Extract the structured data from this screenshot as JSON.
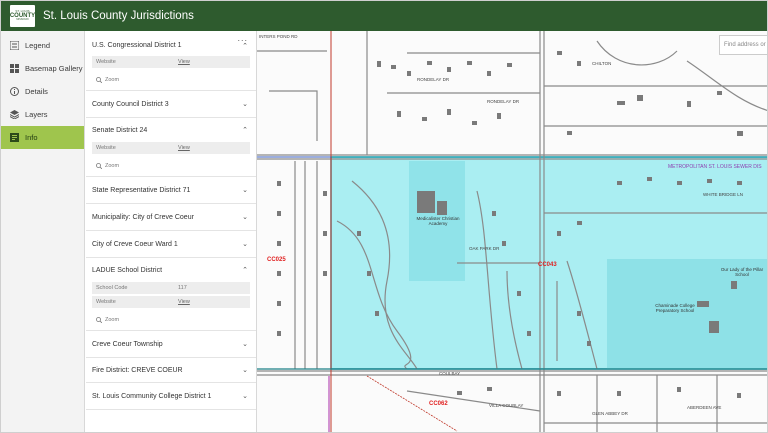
{
  "header": {
    "title": "St. Louis County Jurisdictions",
    "logo": {
      "line1": "ST. LOUIS",
      "line2": "COUNTY",
      "line3": "MISSOURI"
    }
  },
  "nav": {
    "items": [
      {
        "label": "Legend",
        "icon": "legend-icon"
      },
      {
        "label": "Basemap Gallery",
        "icon": "basemap-icon"
      },
      {
        "label": "Details",
        "icon": "info-icon"
      },
      {
        "label": "Layers",
        "icon": "layers-icon"
      },
      {
        "label": "Info",
        "icon": "info-card-icon",
        "active": true
      }
    ]
  },
  "panel": {
    "menu": "...",
    "sections": [
      {
        "title": "U.S. Congressional District 1",
        "expanded": true,
        "rows": [
          {
            "k": "Website",
            "v": "View"
          }
        ],
        "zoom": "Zoom"
      },
      {
        "title": "County Council District 3",
        "expanded": false
      },
      {
        "title": "Senate District 24",
        "expanded": true,
        "rows": [
          {
            "k": "Website",
            "v": "View"
          }
        ],
        "zoom": "Zoom"
      },
      {
        "title": "State Representative District 71",
        "expanded": false
      },
      {
        "title": "Municipality: City of Creve Coeur",
        "expanded": false
      },
      {
        "title": "City of Creve Coeur Ward 1",
        "expanded": false
      },
      {
        "title": "LADUE School District",
        "expanded": true,
        "rows": [
          {
            "k": "School Code",
            "v": "117"
          },
          {
            "k": "Website",
            "v": "View"
          }
        ],
        "zoom": "Zoom"
      },
      {
        "title": "Creve Coeur Township",
        "expanded": false
      },
      {
        "title": "Fire District: CREVE COEUR",
        "expanded": false
      },
      {
        "title": "St. Louis Community College District 1",
        "expanded": false
      }
    ]
  },
  "map": {
    "search_placeholder": "Find address or",
    "labels": {
      "cc043": "CC043",
      "cc025": "CC025",
      "cc062": "CC062",
      "msd": "METROPOLITAN ST. LOUIS SEWER DIS",
      "academy": "Medicalister Christian Academy",
      "chaminade": "Chaminade College Preparatory School",
      "olp": "Our Lady of the Pillar School",
      "dr1": "RONDELAY DR",
      "dr2": "RONDELAY DR",
      "dr3": "CHILTON",
      "dr4": "WHITE BRIDGE LN",
      "dr5": "OAK PARK DR",
      "dr6": "COULBAY",
      "dr7": "GLEN ABBEY DR",
      "dr8": "INTERS POND RD",
      "dr9": "VILLA COUBLAY",
      "dr10": "ABERDEEN AVE"
    },
    "colors": {
      "highlight": "#8fe9ef",
      "highlight_border": "#1a9cad",
      "boundary_red": "#c0392b",
      "boundary_purple": "#b84fb8",
      "boundary_teal": "#1c7f86",
      "label_red": "#e02020",
      "label_purple": "#8d3fb0"
    }
  }
}
